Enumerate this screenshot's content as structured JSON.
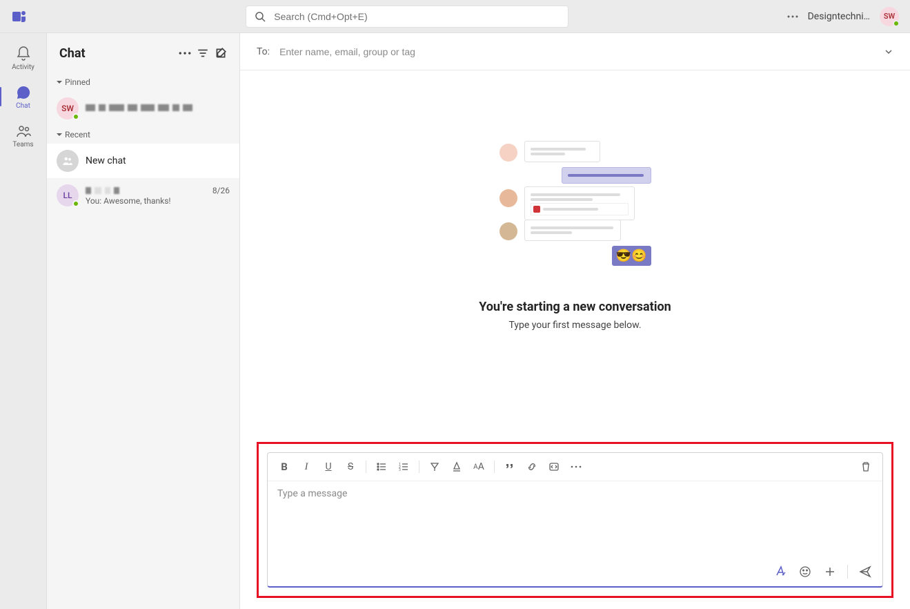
{
  "topbar": {
    "search_placeholder": "Search (Cmd+Opt+E)",
    "org_name": "Designtechni…",
    "avatar_initials": "SW"
  },
  "rail": {
    "activity": "Activity",
    "chat": "Chat",
    "teams": "Teams"
  },
  "chatlist": {
    "title": "Chat",
    "pinned_label": "Pinned",
    "recent_label": "Recent",
    "pinned_avatar": "SW",
    "new_chat_label": "New chat",
    "ll_avatar": "LL",
    "ll_time": "8/26",
    "ll_preview": "You: Awesome, thanks!"
  },
  "content": {
    "to_label": "To:",
    "to_placeholder": "Enter name, email, group or tag",
    "empty_heading": "You're starting a new conversation",
    "empty_sub": "Type your first message below."
  },
  "compose": {
    "placeholder": "Type a message"
  }
}
